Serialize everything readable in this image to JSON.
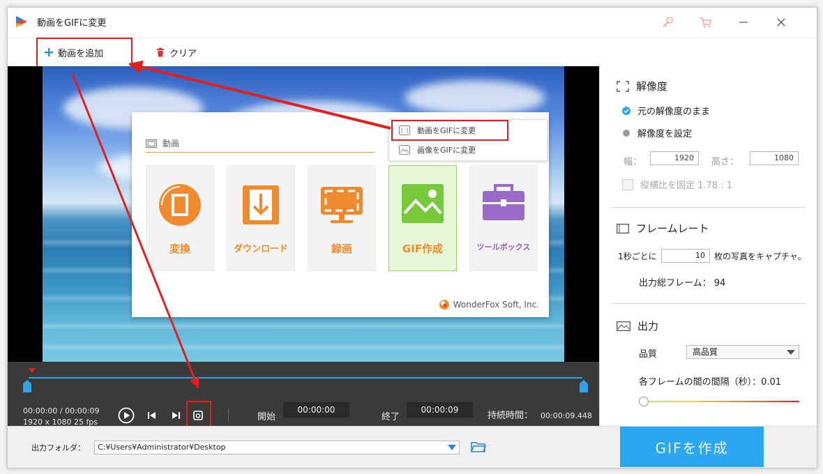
{
  "window": {
    "title": "動画をGIFに変更"
  },
  "toolbar": {
    "add_label": "動画を追加",
    "clear_label": "クリア"
  },
  "card": {
    "section_label": "動画",
    "tiles": [
      {
        "label": "変換",
        "color": "#f08a2e"
      },
      {
        "label": "ダウンロード",
        "color": "#f08a2e"
      },
      {
        "label": "録画",
        "color": "#f08a2e"
      },
      {
        "label": "GIF作成",
        "color": "#f08a2e"
      },
      {
        "label": "ツールボックス",
        "color": "#8e5fc0"
      }
    ],
    "brand": "WonderFox Soft, Inc.",
    "menu": {
      "item1": "動画をGIFに変更",
      "item2": "画像をGIFに変更"
    }
  },
  "player": {
    "time": "00:00:00  /  00:00:09",
    "resolution": "1920 x 1080    25 fps",
    "start_label": "開始",
    "start_time": "00:00:00",
    "end_label": "終了",
    "end_time": "00:00:09",
    "duration_label": "持続時間：",
    "duration": "00:00:09.448"
  },
  "settings": {
    "resolution": {
      "title": "解像度",
      "opt_keep": "元の解像度のまま",
      "opt_set": "解像度を設定",
      "width_label": "幅：",
      "width": "1920",
      "height_label": "高さ：",
      "height": "1080",
      "aspect_lock": "縦横比を固定  1.78 : 1"
    },
    "framerate": {
      "title": "フレームレート",
      "prefix": "1秒ごとに",
      "value": "10",
      "suffix": "枚の写真をキャプチャ。",
      "total": "出力総フレーム：  94"
    },
    "output": {
      "title": "出力",
      "quality_label": "品質",
      "quality": "高品質",
      "interval": "各フレームの間の間隔（秒）：0.01",
      "interval_slider_level": 0
    }
  },
  "bottom": {
    "folder_label": "出力フォルダ：",
    "folder_path": "C:¥Users¥Administrator¥Desktop",
    "create_label": "GIFを作成"
  },
  "colors": {
    "accent": "#2ba6f0",
    "highlight": "#e02020",
    "orange": "#f08a2e"
  }
}
